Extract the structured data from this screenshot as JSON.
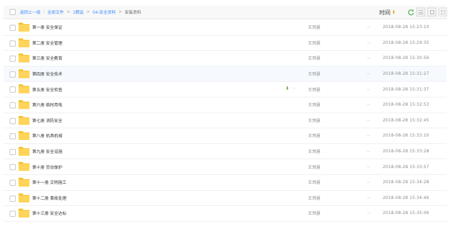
{
  "header": {
    "breadcrumbs": [
      {
        "label": "返回上一级",
        "link": true
      },
      {
        "label": "全部文件",
        "link": true
      },
      {
        "label": "1精选",
        "link": true
      },
      {
        "label": "04-安全资料",
        "link": true
      },
      {
        "label": "安装资料",
        "link": false
      }
    ],
    "sort_label": "时间",
    "sort_arrow": "⬆"
  },
  "rows": [
    {
      "name": "第一册 安全保证",
      "owner": "王玮慧",
      "dash": "--",
      "date": "2018-08-28 15:23:10"
    },
    {
      "name": "第二册 安全管理",
      "owner": "王玮慧",
      "dash": "--",
      "date": "2018-08-28 15:29:35"
    },
    {
      "name": "第三册 安全教育",
      "owner": "王玮慧",
      "dash": "--",
      "date": "2018-08-28 15:30:56"
    },
    {
      "name": "第四册 安全技术",
      "owner": "王玮慧",
      "dash": "--",
      "date": "2018-08-28 15:31:27"
    },
    {
      "name": "第五册 安全检查",
      "owner": "王玮慧",
      "dash": "--",
      "date": "2018-08-28 15:31:37"
    },
    {
      "name": "第六册 临时用电",
      "owner": "王玮慧",
      "dash": "--",
      "date": "2018-08-28 15:32:53"
    },
    {
      "name": "第七册 消防安全",
      "owner": "王玮慧",
      "dash": "--",
      "date": "2018-08-28 15:32:45"
    },
    {
      "name": "第八册 机具机械",
      "owner": "王玮慧",
      "dash": "--",
      "date": "2018-08-28 15:33:10"
    },
    {
      "name": "第九册 安全设施",
      "owner": "王玮慧",
      "dash": "--",
      "date": "2018-08-28 15:33:28"
    },
    {
      "name": "第十册 劳动保护",
      "owner": "王玮慧",
      "dash": "--",
      "date": "2018-08-28 15:33:57"
    },
    {
      "name": "第十一册 文明施工",
      "owner": "王玮慧",
      "dash": "--",
      "date": "2018-08-28 15:34:28"
    },
    {
      "name": "第十二册 事故处理",
      "owner": "王玮慧",
      "dash": "--",
      "date": "2018-08-28 15:34:46"
    },
    {
      "name": "第十三册 安全达标",
      "owner": "王玮慧",
      "dash": "--",
      "date": "2018-08-28 15:35:06"
    }
  ],
  "row_action_icons": {
    "download": "download-icon",
    "more": "more-icon"
  },
  "colors": {
    "link": "#3b8cff",
    "folder": "#ffd45a",
    "refresh": "#5cb85c",
    "sort_arrow": "#e8a200"
  }
}
